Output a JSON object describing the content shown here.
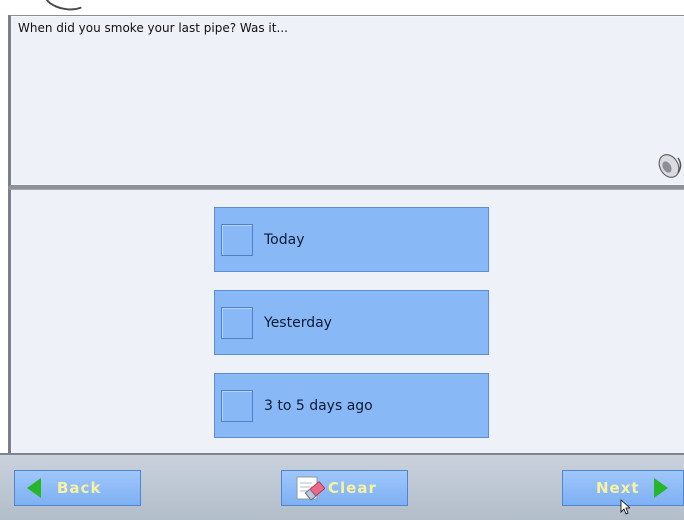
{
  "question": {
    "text": "When did you smoke your last pipe? Was it..."
  },
  "options": [
    {
      "label": "Today",
      "checked": false
    },
    {
      "label": "Yesterday",
      "checked": false
    },
    {
      "label": "3 to 5 days ago",
      "checked": false
    }
  ],
  "navigation": {
    "back_label": "Back",
    "clear_label": "Clear",
    "next_label": "Next"
  },
  "icons": {
    "speaker": "speaker-icon",
    "eraser": "eraser-icon",
    "back_arrow": "triangle-left-icon",
    "next_arrow": "triangle-right-icon"
  },
  "colors": {
    "option_fill": "#89b8f7",
    "nav_text": "#f7f2a0",
    "arrow_green": "#27b52a"
  }
}
